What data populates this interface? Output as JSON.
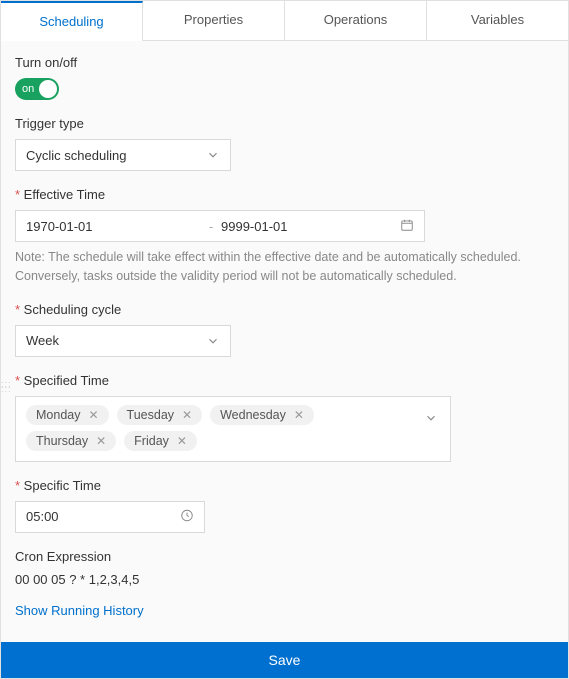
{
  "tabs": {
    "scheduling": "Scheduling",
    "properties": "Properties",
    "operations": "Operations",
    "variables": "Variables"
  },
  "toggle": {
    "label": "Turn on/off",
    "state_label": "on"
  },
  "trigger_type": {
    "label": "Trigger type",
    "value": "Cyclic scheduling"
  },
  "effective_time": {
    "label": "Effective Time",
    "from": "1970-01-01",
    "sep": "-",
    "to": "9999-01-01",
    "note": "Note: The schedule will take effect within the effective date and be automatically scheduled. Conversely, tasks outside the validity period will not be automatically scheduled."
  },
  "scheduling_cycle": {
    "label": "Scheduling cycle",
    "value": "Week"
  },
  "specified_time": {
    "label": "Specified Time",
    "tags": [
      "Monday",
      "Tuesday",
      "Wednesday",
      "Thursday",
      "Friday"
    ]
  },
  "specific_time": {
    "label": "Specific Time",
    "value": "05:00"
  },
  "cron": {
    "label": "Cron Expression",
    "value": "00 00 05 ? * 1,2,3,4,5"
  },
  "links": {
    "show_history": "Show Running History"
  },
  "actions": {
    "save": "Save"
  }
}
